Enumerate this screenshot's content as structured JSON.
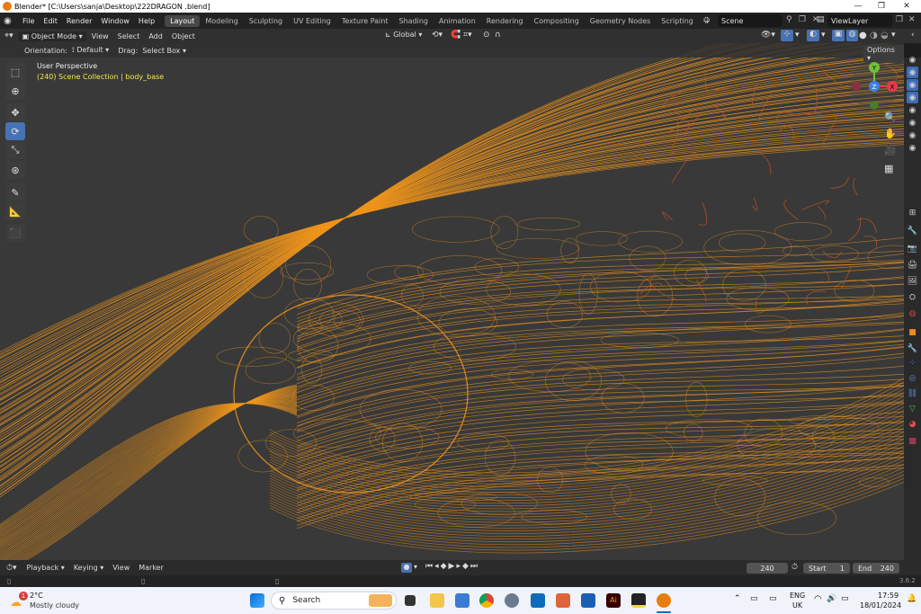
{
  "window": {
    "title": "Blender* [C:\\Users\\sanja\\Desktop\\222DRAGON .blend]",
    "controls": [
      "—",
      "❐",
      "✕"
    ]
  },
  "menu": [
    "File",
    "Edit",
    "Render",
    "Window",
    "Help"
  ],
  "workspaces": [
    "Layout",
    "Modeling",
    "Sculpting",
    "UV Editing",
    "Texture Paint",
    "Shading",
    "Animation",
    "Rendering",
    "Compositing",
    "Geometry Nodes",
    "Scripting",
    "+"
  ],
  "active_workspace": "Layout",
  "scene": {
    "label": "Scene",
    "view_layer": "ViewLayer"
  },
  "header": {
    "mode": "Object Mode",
    "menus": [
      "View",
      "Select",
      "Add",
      "Object"
    ],
    "transform_orientation": "Global",
    "options": "Options"
  },
  "toolsettings": {
    "orientation_label": "Orientation:",
    "orientation_value": "Default",
    "drag_label": "Drag:",
    "drag_value": "Select Box"
  },
  "viewport": {
    "view_name": "User Perspective",
    "collection_info": "(240) Scene Collection | body_base",
    "gizmo_axes": {
      "y": "Y",
      "z": "Z",
      "x": "X"
    }
  },
  "timeline": {
    "menus": [
      "Playback",
      "Keying",
      "View",
      "Marker"
    ],
    "current_frame": "240",
    "start_label": "Start",
    "start": "1",
    "end_label": "End",
    "end": "240"
  },
  "statusbar": {
    "version": "3.6.2"
  },
  "taskbar": {
    "weather_temp": "2°C",
    "weather_desc": "Mostly cloudy",
    "weather_badge": "1",
    "search_placeholder": "Search",
    "lang": "ENG",
    "region": "UK",
    "time": "17:59",
    "date": "18/01/2024"
  },
  "colors": {
    "wire": "#f0951c",
    "wire_dark": "#c8561e",
    "accent": "#4772b3",
    "collection_text": "#f0e84a"
  }
}
